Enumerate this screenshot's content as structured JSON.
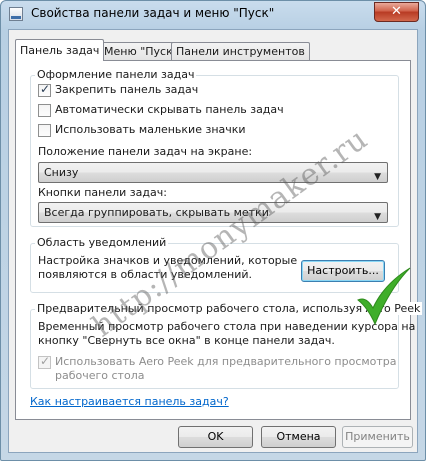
{
  "window": {
    "title": "Свойства панели задач и меню \"Пуск\"",
    "close_glyph": "✕"
  },
  "tabs": [
    {
      "label": "Панель задач",
      "active": true
    },
    {
      "label": "Меню \"Пуск\"",
      "active": false
    },
    {
      "label": "Панели инструментов",
      "active": false
    }
  ],
  "appearance": {
    "title": "Оформление панели задач",
    "checkboxes": [
      {
        "label": "Закрепить панель задач",
        "checked": true
      },
      {
        "label": "Автоматически скрывать панель задач",
        "checked": false
      },
      {
        "label": "Использовать маленькие значки",
        "checked": false
      }
    ],
    "position_label": "Положение панели задач на экране:",
    "position_value": "Снизу",
    "buttons_label": "Кнопки панели задач:",
    "buttons_value": "Всегда группировать, скрывать метки"
  },
  "notifications": {
    "title": "Область уведомлений",
    "description_line1": "Настройка значков и уведомлений, которые",
    "description_line2": "появляются в области уведомлений.",
    "customize_button": "Настроить..."
  },
  "aero_peek": {
    "title": "Предварительный просмотр рабочего стола, используя Aero Peek",
    "description_line1": "Временный просмотр рабочего стола при наведении курсора на",
    "description_line2": "кнопку \"Свернуть все окна\" в конце панели задач.",
    "checkbox_label_line1": "Использовать Aero Peek для предварительного просмотра",
    "checkbox_label_line2": "рабочего стола",
    "checkbox_checked": true,
    "checkbox_disabled": true
  },
  "help_link": "Как настраивается панель задач?",
  "footer": {
    "ok": "OK",
    "cancel": "Отмена",
    "apply": "Применить"
  },
  "watermark": {
    "text": "http://monymaker.ru",
    "check_color": "#3fae2a"
  }
}
